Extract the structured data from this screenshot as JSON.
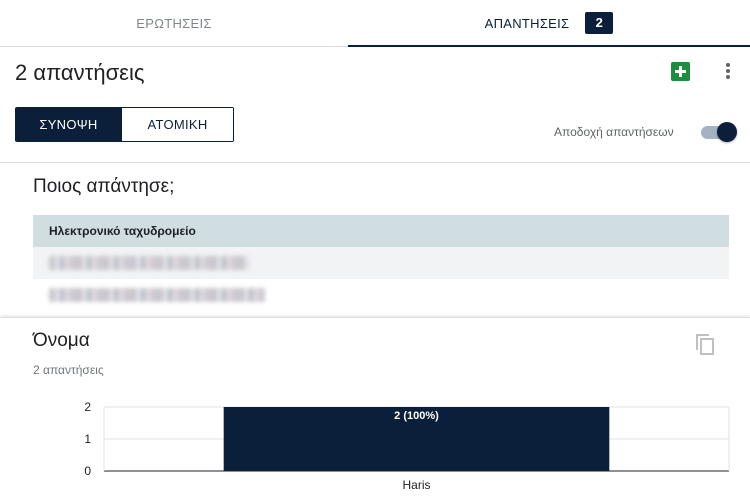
{
  "tabs": {
    "questions": "ΕΡΩΤΗΣΕΙΣ",
    "responses": "ΑΠΑΝΤΗΣΕΙΣ",
    "responses_count": "2"
  },
  "header": {
    "title": "2 απαντήσεις"
  },
  "view_toggle": {
    "summary": "ΣΥΝΟΨΗ",
    "individual": "ΑΤΟΜΙΚΗ"
  },
  "accepting": {
    "label": "Αποδοχή απαντήσεων",
    "on": true
  },
  "who_responded": {
    "title": "Ποιος απάντησε;",
    "column_header": "Ηλεκτρονικό ταχυδρομείο"
  },
  "name_question": {
    "title": "Όνομα",
    "subtitle": "2 απαντήσεις"
  },
  "chart_data": {
    "type": "bar",
    "categories": [
      "Haris"
    ],
    "values": [
      2
    ],
    "data_labels": [
      "2 (100%)"
    ],
    "ylim": [
      0,
      2
    ],
    "yticks": [
      "0",
      "1",
      "2"
    ],
    "grid": true,
    "bar_color": "#0b1f3a"
  },
  "colors": {
    "accent": "#0b1f3a",
    "sheets_green": "#1e8e3e",
    "table_header": "#d0dee2"
  }
}
